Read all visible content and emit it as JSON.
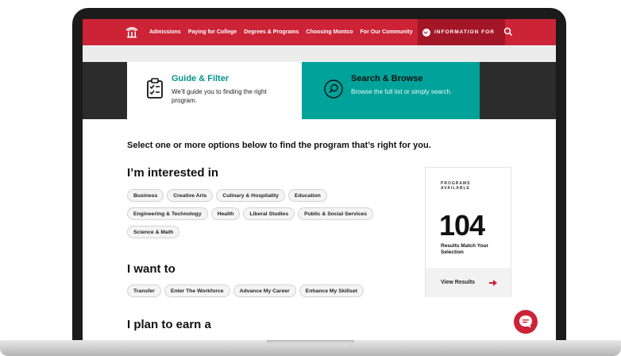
{
  "nav": {
    "links": [
      "Admissions",
      "Paying for College",
      "Degrees & Programs",
      "Choosing Montco",
      "For Our Community"
    ],
    "info_label": "INFORMATION FOR"
  },
  "tabs": {
    "guide": {
      "title": "Guide & Filter",
      "desc": "We'll guide you to finding the right program."
    },
    "search": {
      "title": "Search & Browse",
      "desc": "Browse the full list or simply search."
    }
  },
  "prompt": "Select one or more options below to find the program that’s right for you.",
  "interested": {
    "title": "I’m interested in",
    "chips": [
      "Business",
      "Creative Arts",
      "Culinary & Hospitality",
      "Education",
      "Engineering & Technology",
      "Health",
      "Liberal Studies",
      "Public & Social Services",
      "Science & Math"
    ]
  },
  "want": {
    "title": "I want to",
    "chips": [
      "Transfer",
      "Enter The Workforce",
      "Advance My Career",
      "Enhance My Skillset"
    ]
  },
  "earn": {
    "title": "I plan to earn a"
  },
  "results": {
    "label": "PROGRAMS AVAILABLE",
    "count": "104",
    "sub": "Results Match Your Selection",
    "view": "View Results"
  },
  "colors": {
    "brand_red": "#cc2336",
    "teal": "#00a29a"
  },
  "icons": {
    "logo": "building-icon",
    "search": "search-icon",
    "chat": "chat-icon",
    "guide": "checklist-icon",
    "browse": "magnifier-icon"
  }
}
